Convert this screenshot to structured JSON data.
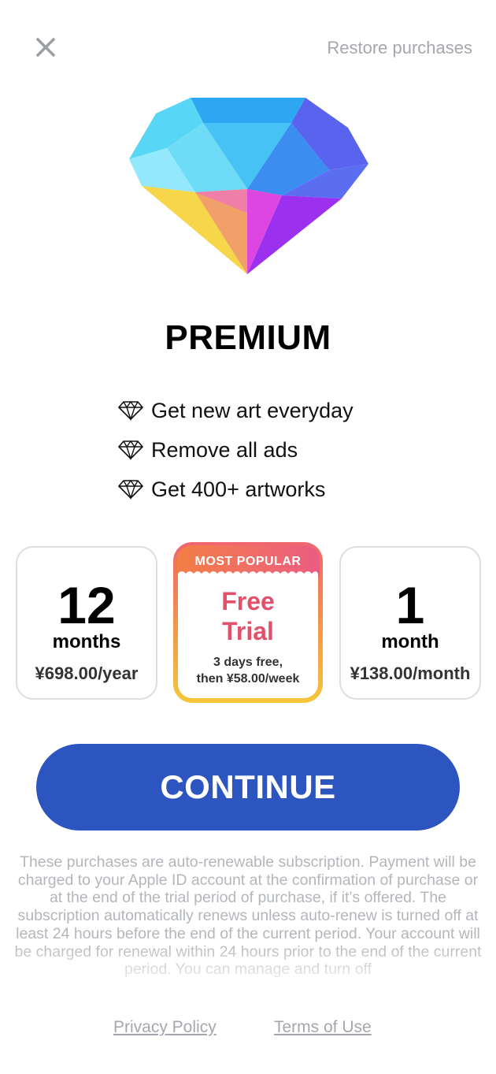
{
  "header": {
    "close_icon": "close-icon",
    "restore_label": "Restore purchases"
  },
  "hero": {
    "icon": "diamond-gem-icon",
    "title": "PREMIUM"
  },
  "features": [
    {
      "icon": "diamond-outline-icon",
      "label": "Get new art everyday"
    },
    {
      "icon": "diamond-outline-icon",
      "label": "Remove all ads"
    },
    {
      "icon": "diamond-outline-icon",
      "label": "Get 400+ artworks"
    }
  ],
  "plans": {
    "yearly": {
      "big": "12",
      "unit": "months",
      "price": "¥698.00/year"
    },
    "trial": {
      "badge": "MOST POPULAR",
      "line1": "Free",
      "line2": "Trial",
      "sub1": "3 days free,",
      "sub2": "then ¥58.00/week"
    },
    "monthly": {
      "big": "1",
      "unit": "month",
      "price": "¥138.00/month"
    }
  },
  "continue_label": "CONTINUE",
  "legal_text": "These purchases are auto-renewable subscription. Payment will be charged to your Apple ID account at the confirmation of purchase or at the end of the trial period of purchase, if it’s offered. The subscription automatically renews unless auto-renew is turned off at least 24 hours before the end of the current period. Your account will be charged for renewal within 24 hours prior to the end of the current period. You can manage and turn off",
  "footer": {
    "privacy_label": "Privacy Policy",
    "terms_label": "Terms of Use"
  },
  "colors": {
    "accent": "#2d55bf",
    "trial_red": "#e2506a",
    "muted": "#a4a7ad"
  }
}
